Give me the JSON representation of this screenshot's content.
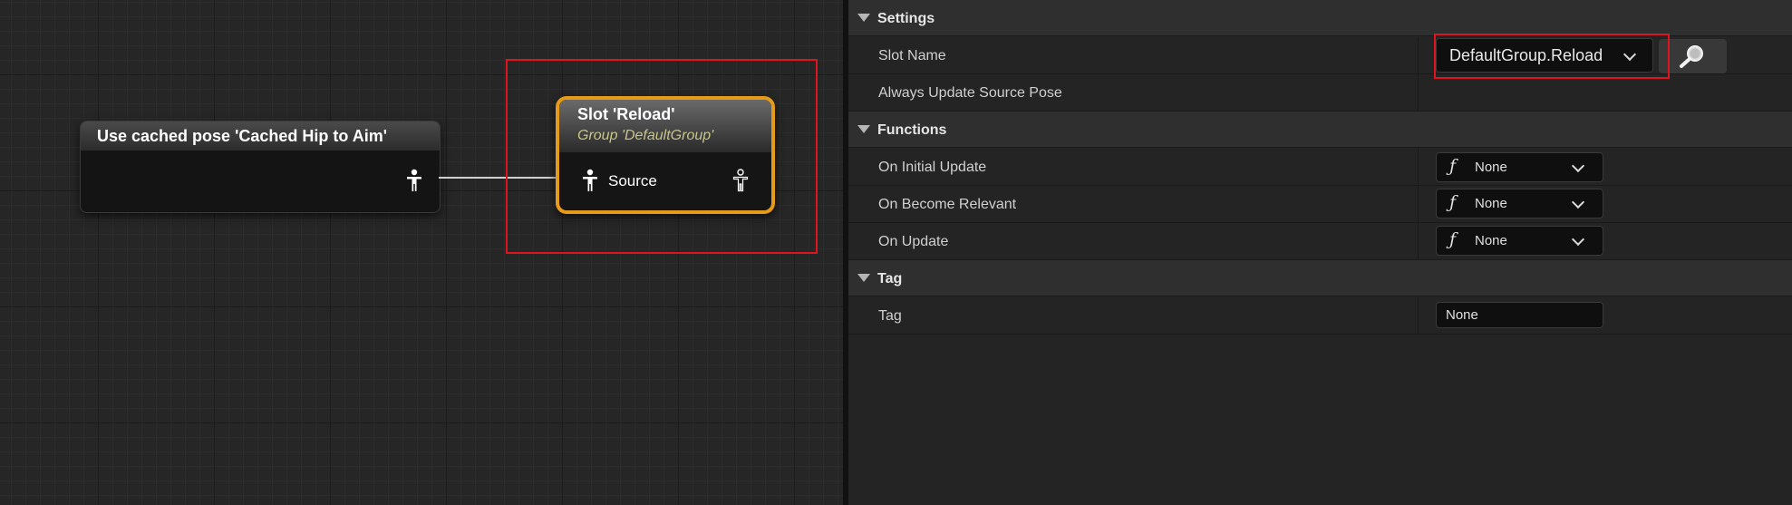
{
  "graph": {
    "cached_node": {
      "title": "Use cached pose 'Cached Hip to Aim'"
    },
    "slot_node": {
      "title": "Slot 'Reload'",
      "subtitle": "Group 'DefaultGroup'",
      "pin_label": "Source"
    }
  },
  "details": {
    "settings": {
      "header": "Settings",
      "slot_name_label": "Slot Name",
      "slot_name_value": "DefaultGroup.Reload",
      "always_update_label": "Always Update Source Pose",
      "always_update_checked": false
    },
    "functions": {
      "header": "Functions",
      "rows": [
        {
          "label": "On Initial Update",
          "value": "None"
        },
        {
          "label": "On Become Relevant",
          "value": "None"
        },
        {
          "label": "On Update",
          "value": "None"
        }
      ]
    },
    "tag": {
      "header": "Tag",
      "label": "Tag",
      "value": "None"
    }
  },
  "colors": {
    "node_selected_border": "#e59a1a",
    "highlight_box": "#e0141e",
    "slot_subtitle": "#c8c48a"
  }
}
